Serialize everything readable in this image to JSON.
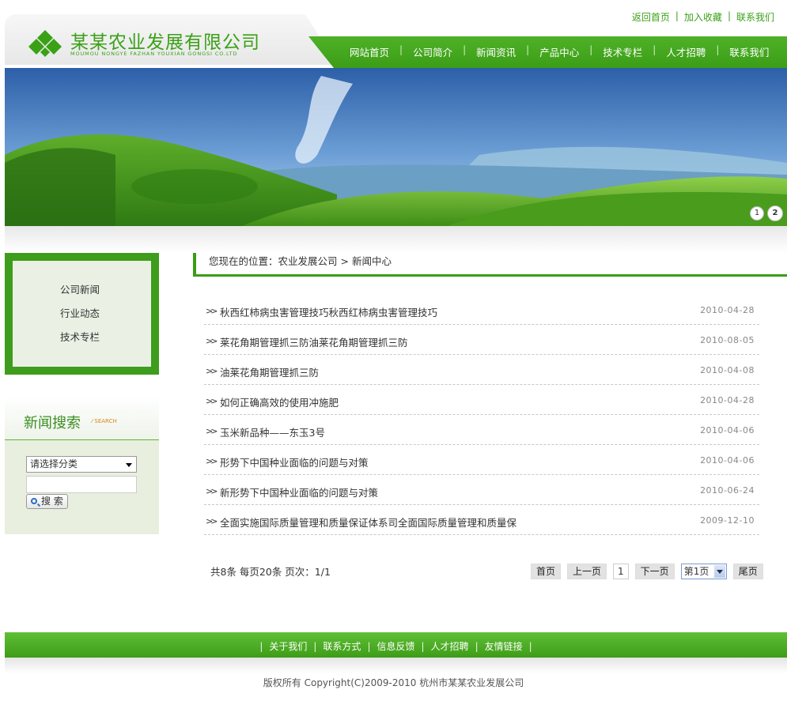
{
  "brand": {
    "title": "某某农业发展有限公司",
    "subtitle": "MOUMOU NONGYE FAZHAN YOUXIAN GONGSI CO.LTD",
    "accent": "#3aa117"
  },
  "toplinks": [
    "返回首页",
    "加入收藏",
    "联系我们"
  ],
  "nav": [
    "网站首页",
    "公司简介",
    "新闻资讯",
    "产品中心",
    "技术专栏",
    "人才招聘",
    "联系我们"
  ],
  "banner": {
    "dots": [
      "1",
      "2"
    ],
    "active_dot": 2
  },
  "sidebar": {
    "items": [
      "公司新闻",
      "行业动态",
      "技术专栏"
    ]
  },
  "search": {
    "title": "新闻搜索",
    "title_en": "⁄ SEARCH",
    "select_value": "请选择分类",
    "input_value": "",
    "button": "搜 索"
  },
  "breadcrumb": {
    "prefix": "您现在的位置：",
    "home": "农业发展公司",
    "sep": " > ",
    "current": "新闻中心"
  },
  "news": [
    {
      "title": "秋西红柿病虫害管理技巧秋西红柿病虫害管理技巧",
      "date": "2010-04-28"
    },
    {
      "title": "莱花角期管理抓三防油莱花角期管理抓三防",
      "date": "2010-08-05"
    },
    {
      "title": "油莱花角期管理抓三防",
      "date": "2010-04-08"
    },
    {
      "title": "如何正确高效的使用冲施肥",
      "date": "2010-04-28"
    },
    {
      "title": "玉米新品种——东玉3号",
      "date": "2010-04-06"
    },
    {
      "title": "形势下中国种业面临的问题与对策",
      "date": "2010-04-06"
    },
    {
      "title": "新形势下中国种业面临的问题与对策",
      "date": "2010-06-24"
    },
    {
      "title": "全面实施国际质量管理和质量保证体系司全面国际质量管理和质量保",
      "date": "2009-12-10"
    }
  ],
  "pager": {
    "info": "共8条  每页20条  页次：1/1",
    "first": "首页",
    "prev": "上一页",
    "page": "1",
    "next": "下一页",
    "select_value": "第1页",
    "last": "尾页"
  },
  "footer": {
    "links": [
      "关于我们",
      "联系方式",
      "信息反馈",
      "人才招聘",
      "友情链接"
    ],
    "copyright": "版权所有  Copyright(C)2009-2010 杭州市某某农业发展公司"
  }
}
